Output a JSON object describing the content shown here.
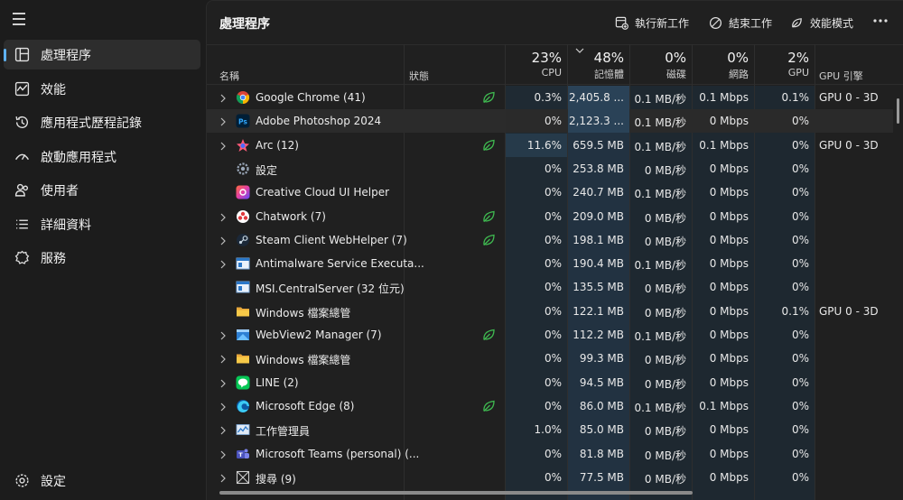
{
  "nav": {
    "items": [
      {
        "label": "處理程序",
        "icon": "processes-icon"
      },
      {
        "label": "效能",
        "icon": "performance-icon"
      },
      {
        "label": "應用程式歷程記錄",
        "icon": "history-icon"
      },
      {
        "label": "啟動應用程式",
        "icon": "startup-icon"
      },
      {
        "label": "使用者",
        "icon": "users-icon"
      },
      {
        "label": "詳細資料",
        "icon": "details-icon"
      },
      {
        "label": "服務",
        "icon": "services-icon"
      }
    ],
    "settings_label": "設定"
  },
  "header": {
    "title": "處理程序",
    "run_task": "執行新工作",
    "end_task": "結束工作",
    "efficiency_mode": "效能模式"
  },
  "columns": {
    "name": "名稱",
    "status": "狀態",
    "cpu": {
      "pct": "23%",
      "label": "CPU"
    },
    "memory": {
      "pct": "48%",
      "label": "記憶體"
    },
    "disk": {
      "pct": "0%",
      "label": "磁碟"
    },
    "network": {
      "pct": "0%",
      "label": "網路"
    },
    "gpu": {
      "pct": "2%",
      "label": "GPU"
    },
    "gpu_engine": "GPU 引擎"
  },
  "rows": [
    {
      "name": "Google Chrome (41)",
      "icon": "chrome-icon",
      "expand": true,
      "leaf": true,
      "cpu": "0.3%",
      "mem": "2,405.8 ...",
      "disk": "0.1 MB/秒",
      "net": "0.1 Mbps",
      "gpu": "0.1%",
      "eng": "GPU 0 - 3D"
    },
    {
      "name": "Adobe Photoshop 2024",
      "icon": "photoshop-icon",
      "expand": true,
      "leaf": false,
      "cpu": "0%",
      "mem": "2,123.3 ...",
      "disk": "0.1 MB/秒",
      "net": "0 Mbps",
      "gpu": "0%",
      "eng": ""
    },
    {
      "name": "Arc (12)",
      "icon": "arc-icon",
      "expand": true,
      "leaf": true,
      "cpu": "11.6%",
      "mem": "659.5 MB",
      "disk": "0.1 MB/秒",
      "net": "0.1 Mbps",
      "gpu": "0%",
      "eng": "GPU 0 - 3D"
    },
    {
      "name": "設定",
      "icon": "settings-gear-icon",
      "expand": false,
      "leaf": false,
      "cpu": "0%",
      "mem": "253.8 MB",
      "disk": "0 MB/秒",
      "net": "0 Mbps",
      "gpu": "0%",
      "eng": ""
    },
    {
      "name": "Creative Cloud UI Helper",
      "icon": "creative-cloud-icon",
      "expand": false,
      "leaf": false,
      "cpu": "0%",
      "mem": "240.7 MB",
      "disk": "0.1 MB/秒",
      "net": "0 Mbps",
      "gpu": "0%",
      "eng": ""
    },
    {
      "name": "Chatwork (7)",
      "icon": "chatwork-icon",
      "expand": true,
      "leaf": true,
      "cpu": "0%",
      "mem": "209.0 MB",
      "disk": "0 MB/秒",
      "net": "0 Mbps",
      "gpu": "0%",
      "eng": ""
    },
    {
      "name": "Steam Client WebHelper (7)",
      "icon": "steam-icon",
      "expand": true,
      "leaf": true,
      "cpu": "0%",
      "mem": "198.1 MB",
      "disk": "0 MB/秒",
      "net": "0 Mbps",
      "gpu": "0%",
      "eng": ""
    },
    {
      "name": "Antimalware Service Executa...",
      "icon": "service-window-icon",
      "expand": true,
      "leaf": false,
      "cpu": "0%",
      "mem": "190.4 MB",
      "disk": "0.1 MB/秒",
      "net": "0 Mbps",
      "gpu": "0%",
      "eng": ""
    },
    {
      "name": "MSI.CentralServer (32 位元)",
      "icon": "service-window-icon",
      "expand": false,
      "leaf": false,
      "cpu": "0%",
      "mem": "135.5 MB",
      "disk": "0 MB/秒",
      "net": "0 Mbps",
      "gpu": "0%",
      "eng": ""
    },
    {
      "name": "Windows 檔案總管",
      "icon": "folder-icon",
      "expand": false,
      "leaf": false,
      "cpu": "0%",
      "mem": "122.1 MB",
      "disk": "0 MB/秒",
      "net": "0 Mbps",
      "gpu": "0.1%",
      "eng": "GPU 0 - 3D"
    },
    {
      "name": "WebView2 Manager (7)",
      "icon": "webview-icon",
      "expand": true,
      "leaf": true,
      "cpu": "0%",
      "mem": "112.2 MB",
      "disk": "0.1 MB/秒",
      "net": "0 Mbps",
      "gpu": "0%",
      "eng": ""
    },
    {
      "name": "Windows 檔案總管",
      "icon": "folder-icon",
      "expand": true,
      "leaf": false,
      "cpu": "0%",
      "mem": "99.3 MB",
      "disk": "0 MB/秒",
      "net": "0 Mbps",
      "gpu": "0%",
      "eng": ""
    },
    {
      "name": "LINE (2)",
      "icon": "line-icon",
      "expand": true,
      "leaf": false,
      "cpu": "0%",
      "mem": "94.5 MB",
      "disk": "0 MB/秒",
      "net": "0 Mbps",
      "gpu": "0%",
      "eng": ""
    },
    {
      "name": "Microsoft Edge (8)",
      "icon": "edge-icon",
      "expand": true,
      "leaf": true,
      "cpu": "0%",
      "mem": "86.0 MB",
      "disk": "0.1 MB/秒",
      "net": "0.1 Mbps",
      "gpu": "0%",
      "eng": ""
    },
    {
      "name": "工作管理員",
      "icon": "task-manager-icon",
      "expand": true,
      "leaf": false,
      "cpu": "1.0%",
      "mem": "85.0 MB",
      "disk": "0 MB/秒",
      "net": "0 Mbps",
      "gpu": "0%",
      "eng": ""
    },
    {
      "name": "Microsoft Teams (personal) (...",
      "icon": "teams-icon",
      "expand": true,
      "leaf": false,
      "cpu": "0%",
      "mem": "81.8 MB",
      "disk": "0 MB/秒",
      "net": "0 Mbps",
      "gpu": "0%",
      "eng": ""
    },
    {
      "name": "搜尋 (9)",
      "icon": "search-app-icon",
      "expand": true,
      "leaf": false,
      "cpu": "0%",
      "mem": "77.5 MB",
      "disk": "0 MB/秒",
      "net": "0 Mbps",
      "gpu": "0%",
      "eng": ""
    }
  ],
  "colors": {
    "accent": "#5fb2f2",
    "leaf": "#3fb950",
    "heat_cpu_high": "#1f3a4c",
    "heat_mem_high": "#243f52",
    "heat_low": "#1e2d38"
  }
}
